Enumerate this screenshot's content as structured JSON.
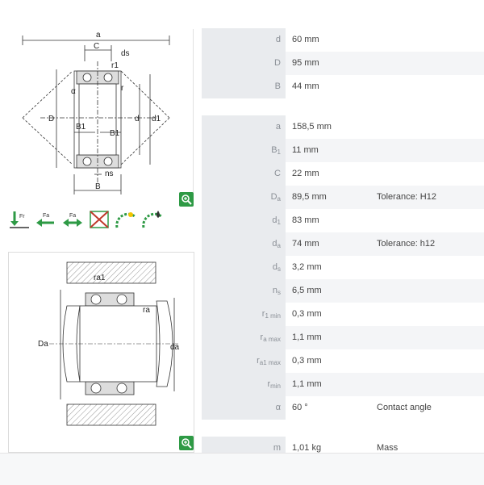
{
  "diagram_top": {
    "labels": {
      "a": "a",
      "C": "C",
      "ds": "ds",
      "r1": "r1",
      "alpha": "α",
      "r": "r",
      "D": "D",
      "d": "d",
      "d1": "d1",
      "B1_left": "B1",
      "B1_right": "B1",
      "ns": "ns",
      "B": "B"
    }
  },
  "diagram_bottom": {
    "labels": {
      "ra1": "ra1",
      "ra": "ra",
      "Da": "Da",
      "da": "da"
    }
  },
  "feature_icons": [
    {
      "name": "axial-load-icon"
    },
    {
      "name": "single-direction-icon"
    },
    {
      "name": "double-direction-icon"
    },
    {
      "name": "not-suitable-icon"
    },
    {
      "name": "speed-icon"
    },
    {
      "name": "lubrication-icon"
    }
  ],
  "groups": [
    {
      "rows": [
        {
          "label": "d",
          "sub": "",
          "value": "60  mm",
          "note": ""
        },
        {
          "label": "D",
          "sub": "",
          "value": "95  mm",
          "note": ""
        },
        {
          "label": "B",
          "sub": "",
          "value": "44  mm",
          "note": ""
        }
      ]
    },
    {
      "rows": [
        {
          "label": "a",
          "sub": "",
          "value": "158,5  mm",
          "note": ""
        },
        {
          "label": "B",
          "sub": "1",
          "value": "11  mm",
          "note": ""
        },
        {
          "label": "C",
          "sub": "",
          "value": "22  mm",
          "note": ""
        },
        {
          "label": "D",
          "sub": "a",
          "value": "89,5  mm",
          "note": "Tolerance: H12"
        },
        {
          "label": "d",
          "sub": "1",
          "value": "83  mm",
          "note": ""
        },
        {
          "label": "d",
          "sub": "a",
          "value": "74  mm",
          "note": "Tolerance: h12"
        },
        {
          "label": "d",
          "sub": "s",
          "value": "3,2  mm",
          "note": ""
        },
        {
          "label": "n",
          "sub": "s",
          "value": "6,5  mm",
          "note": ""
        },
        {
          "label": "r",
          "sub": "1 min",
          "value": "0,3  mm",
          "note": ""
        },
        {
          "label": "r",
          "sub": "a max",
          "value": "1,1  mm",
          "note": ""
        },
        {
          "label": "r",
          "sub": "a1 max",
          "value": "0,3  mm",
          "note": ""
        },
        {
          "label": "r",
          "sub": "min",
          "value": "1,1  mm",
          "note": ""
        },
        {
          "label": "α",
          "sub": "",
          "value": "60  °",
          "note": "Contact angle"
        }
      ]
    },
    {
      "rows": [
        {
          "label": "m",
          "sub": "",
          "value": "1,01  kg",
          "note": "Mass"
        }
      ]
    }
  ]
}
